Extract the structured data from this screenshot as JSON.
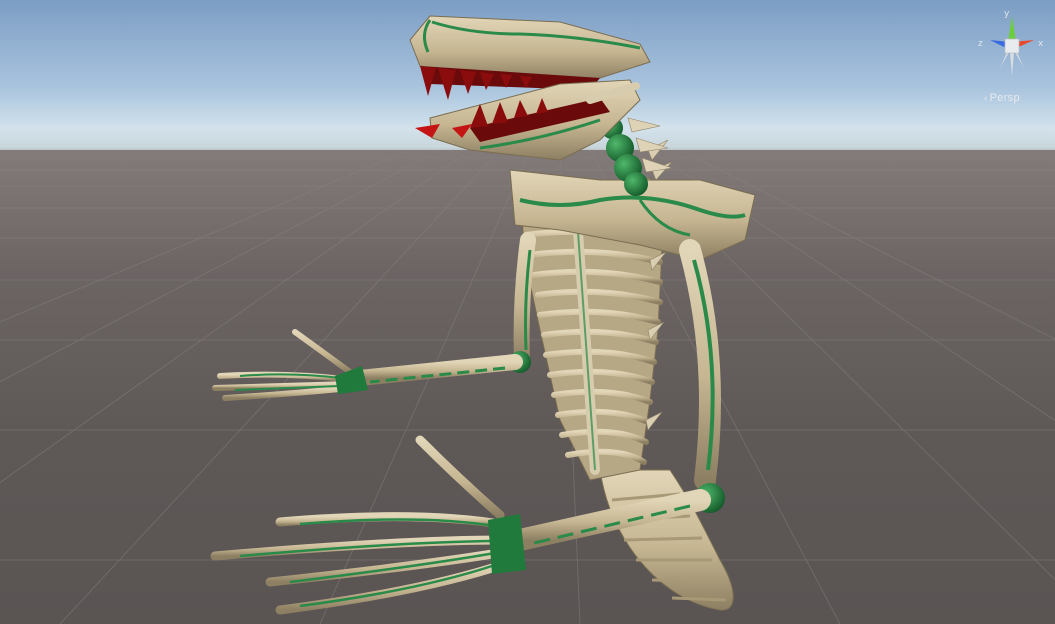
{
  "scene_view": {
    "projection_label": "Persp",
    "projection_icon": "chevron-left-icon",
    "gizmo": {
      "axis_y": "y",
      "axis_x": "x",
      "axis_z": "z",
      "color_y": "#6ccf3a",
      "color_x": "#e8482c",
      "color_z": "#3a6ae0"
    }
  },
  "colors": {
    "bone": "#cdbf9e",
    "bone_shadow": "#8f8266",
    "vein": "#2a8a4a",
    "joint": "#1f7a3c",
    "teeth": "#8a0c0c",
    "sky_top": "#7c9dc4",
    "ground": "#5d5757"
  }
}
